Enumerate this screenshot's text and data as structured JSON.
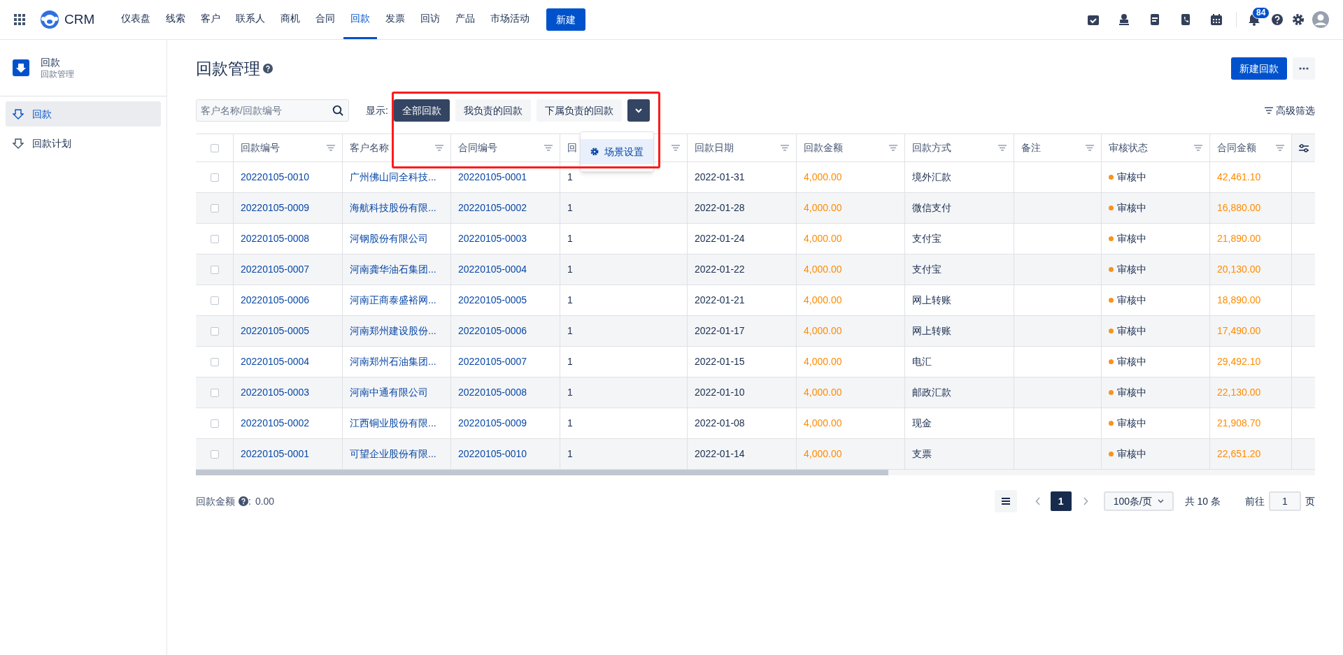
{
  "nav": {
    "logo": "CRM",
    "items": [
      {
        "label": "仪表盘",
        "selected": false
      },
      {
        "label": "线索",
        "selected": false
      },
      {
        "label": "客户",
        "selected": false
      },
      {
        "label": "联系人",
        "selected": false
      },
      {
        "label": "商机",
        "selected": false
      },
      {
        "label": "合同",
        "selected": false
      },
      {
        "label": "回款",
        "selected": true
      },
      {
        "label": "发票",
        "selected": false
      },
      {
        "label": "回访",
        "selected": false
      },
      {
        "label": "产品",
        "selected": false
      },
      {
        "label": "市场活动",
        "selected": false
      }
    ],
    "new_button": "新建",
    "notification_count": "84"
  },
  "sidebar": {
    "module_title": "回款",
    "module_subtitle": "回款管理",
    "items": [
      {
        "label": "回款",
        "selected": true
      },
      {
        "label": "回款计划",
        "selected": false
      }
    ]
  },
  "page": {
    "title": "回款管理",
    "new_button": "新建回款",
    "search": {
      "placeholder": "客户名称/回款编号"
    },
    "filter_label": "显示:",
    "scenes": [
      {
        "label": "全部回款",
        "selected": true
      },
      {
        "label": "我负责的回款",
        "selected": false
      },
      {
        "label": "下属负责的回款",
        "selected": false
      }
    ],
    "scene_menu": {
      "items": [
        {
          "label": "场景设置",
          "selected": true
        }
      ]
    },
    "advanced_filter": "高级筛选"
  },
  "table": {
    "select_all_checked": false,
    "columns": [
      {
        "label": "回款编号"
      },
      {
        "label": "客户名称"
      },
      {
        "label": "合同编号"
      },
      {
        "label": "回"
      },
      {
        "label": "回款日期"
      },
      {
        "label": "回款金额"
      },
      {
        "label": "回款方式"
      },
      {
        "label": "备注"
      },
      {
        "label": "审核状态"
      },
      {
        "label": "合同金额"
      }
    ],
    "rows": [
      {
        "checked": false,
        "payment_no": "20220105-0010",
        "customer": "广州佛山同全科技...",
        "contract_no": "20220105-0001",
        "column_4": "1",
        "date": "2022-01-31",
        "amount": "4,000.00",
        "method": "境外汇款",
        "status": "审核中",
        "contract_amount": "42,461.10"
      },
      {
        "checked": false,
        "payment_no": "20220105-0009",
        "customer": "海航科技股份有限...",
        "contract_no": "20220105-0002",
        "column_4": "1",
        "date": "2022-01-28",
        "amount": "4,000.00",
        "method": "微信支付",
        "status": "审核中",
        "contract_amount": "16,880.00"
      },
      {
        "checked": false,
        "payment_no": "20220105-0008",
        "customer": "河钢股份有限公司",
        "contract_no": "20220105-0003",
        "column_4": "1",
        "date": "2022-01-24",
        "amount": "4,000.00",
        "method": "支付宝",
        "status": "审核中",
        "contract_amount": "21,890.00"
      },
      {
        "checked": false,
        "payment_no": "20220105-0007",
        "customer": "河南龚华油石集团...",
        "contract_no": "20220105-0004",
        "column_4": "1",
        "date": "2022-01-22",
        "amount": "4,000.00",
        "method": "支付宝",
        "status": "审核中",
        "contract_amount": "20,130.00"
      },
      {
        "checked": false,
        "payment_no": "20220105-0006",
        "customer": "河南正商泰盛裕网...",
        "contract_no": "20220105-0005",
        "column_4": "1",
        "date": "2022-01-21",
        "amount": "4,000.00",
        "method": "网上转账",
        "status": "审核中",
        "contract_amount": "18,890.00"
      },
      {
        "checked": false,
        "payment_no": "20220105-0005",
        "customer": "河南郑州建设股份...",
        "contract_no": "20220105-0006",
        "column_4": "1",
        "date": "2022-01-17",
        "amount": "4,000.00",
        "method": "网上转账",
        "status": "审核中",
        "contract_amount": "17,490.00"
      },
      {
        "checked": false,
        "payment_no": "20220105-0004",
        "customer": "河南郑州石油集团...",
        "contract_no": "20220105-0007",
        "column_4": "1",
        "date": "2022-01-15",
        "amount": "4,000.00",
        "method": "电汇",
        "status": "审核中",
        "contract_amount": "29,492.10"
      },
      {
        "checked": false,
        "payment_no": "20220105-0003",
        "customer": "河南中通有限公司",
        "contract_no": "20220105-0008",
        "column_4": "1",
        "date": "2022-01-10",
        "amount": "4,000.00",
        "method": "邮政汇款",
        "status": "审核中",
        "contract_amount": "22,130.00"
      },
      {
        "checked": false,
        "payment_no": "20220105-0002",
        "customer": "江西铜业股份有限...",
        "contract_no": "20220105-0009",
        "column_4": "1",
        "date": "2022-01-08",
        "amount": "4,000.00",
        "method": "现金",
        "status": "审核中",
        "contract_amount": "21,908.70"
      },
      {
        "checked": false,
        "payment_no": "20220105-0001",
        "customer": "可望企业股份有限...",
        "contract_no": "20220105-0010",
        "column_4": "1",
        "date": "2022-01-14",
        "amount": "4,000.00",
        "method": "支票",
        "status": "审核中",
        "contract_amount": "22,651.20"
      }
    ]
  },
  "summary": {
    "label": "回款金额",
    "separator": ":",
    "value": "0.00"
  },
  "pagination": {
    "pages": [
      {
        "label": "1",
        "selected": true
      }
    ],
    "page_size": "100条/页",
    "total": "共 10 条",
    "goto_label": "前往",
    "goto_value": "1",
    "goto_suffix": "页"
  }
}
